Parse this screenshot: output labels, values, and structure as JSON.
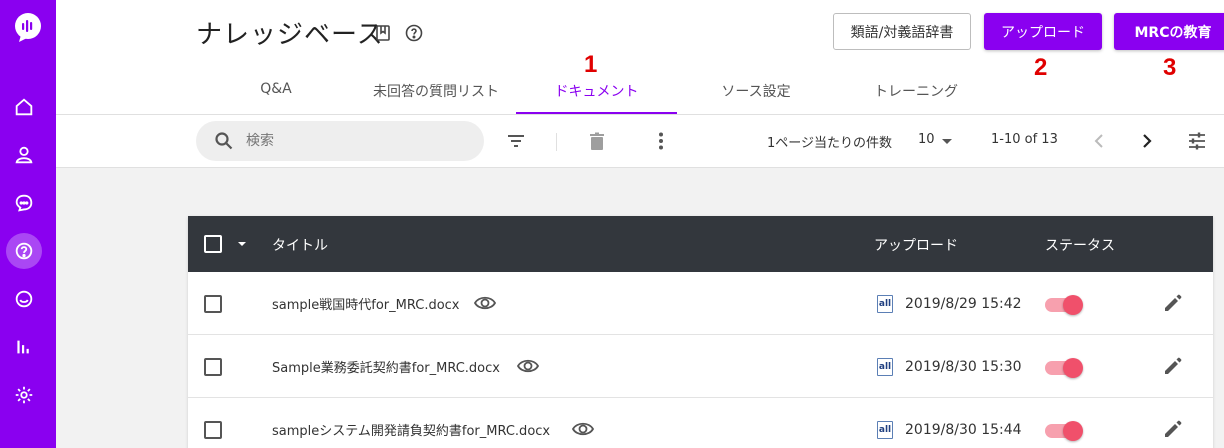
{
  "page": {
    "title": "ナレッジベース",
    "buttons": {
      "dictionary": "類語/対義語辞書",
      "upload": "アップロード",
      "education": "MRCの教育"
    },
    "markers": [
      "1",
      "2",
      "3"
    ]
  },
  "tabs": [
    {
      "label": "Q&A",
      "active": false
    },
    {
      "label": "未回答の質問リスト",
      "active": false
    },
    {
      "label": "ドキュメント",
      "active": true
    },
    {
      "label": "ソース設定",
      "active": false
    },
    {
      "label": "トレーニング",
      "active": false
    }
  ],
  "toolbar": {
    "search_placeholder": "検索",
    "per_page_label": "1ページ当たりの件数",
    "per_page_value": "10",
    "range": "1-10 of 13"
  },
  "table": {
    "columns": {
      "title": "タイトル",
      "upload": "アップロード",
      "status": "ステータス"
    },
    "rows": [
      {
        "name": "sample戦国時代for_MRC.docx",
        "date": "2019/8/29 15:42",
        "enabled": true,
        "file_badge": "all"
      },
      {
        "name": "Sample業務委託契約書for_MRC.docx",
        "date": "2019/8/30 15:30",
        "enabled": true,
        "file_badge": "all"
      },
      {
        "name": "sampleシステム開発請負契約書for_MRC.docx",
        "date": "2019/8/30 15:44",
        "enabled": true,
        "file_badge": "all"
      }
    ]
  },
  "colors": {
    "brand": "#8a00f0",
    "header_dark": "#33373d",
    "toggle_on": "#f0506b",
    "marker": "#e00000"
  },
  "icons": {
    "sidebar": [
      "logo-chat-icon",
      "home-icon",
      "user-icon",
      "chat-bubbles-icon",
      "help-icon",
      "chat-icon",
      "bar-chart-icon",
      "settings-icon"
    ],
    "title": [
      "book-icon",
      "help-circle-icon"
    ],
    "toolbar": [
      "search-icon",
      "filter-icon",
      "delete-icon",
      "more-vert-icon",
      "dropdown-arrow-icon",
      "chevron-left-icon",
      "chevron-right-icon",
      "tune-icon"
    ],
    "row": [
      "eye-icon",
      "word-file-icon",
      "edit-icon"
    ]
  }
}
